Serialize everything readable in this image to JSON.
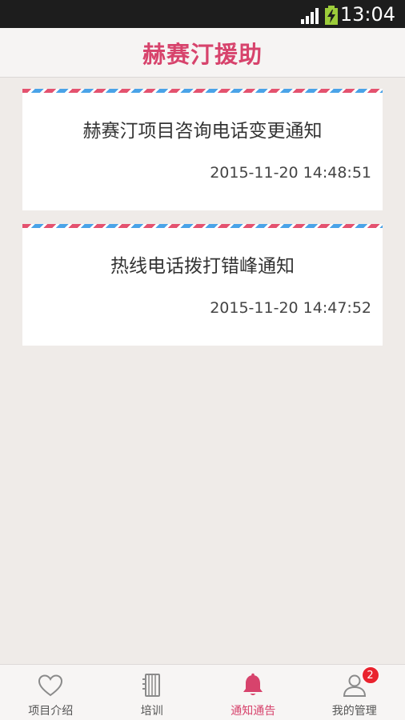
{
  "status_bar": {
    "time": "13:04",
    "signal_icon": "signal-icon",
    "battery_icon": "battery-charging-icon"
  },
  "header": {
    "title": "赫赛汀援助"
  },
  "notices": [
    {
      "title": "赫赛汀项目咨询电话变更通知",
      "time": "2015-11-20 14:48:51"
    },
    {
      "title": "热线电话拨打错峰通知",
      "time": "2015-11-20 14:47:52"
    }
  ],
  "bottom_nav": {
    "items": [
      {
        "label": "项目介绍",
        "icon": "heart-icon"
      },
      {
        "label": "培训",
        "icon": "notebook-icon"
      },
      {
        "label": "通知通告",
        "icon": "bell-icon",
        "active": true
      },
      {
        "label": "我的管理",
        "icon": "user-icon",
        "badge": "2"
      }
    ]
  },
  "colors": {
    "accent": "#d7436c",
    "stripe_red": "#e4526f",
    "stripe_blue": "#4aa3e8",
    "badge": "#e9232e"
  }
}
